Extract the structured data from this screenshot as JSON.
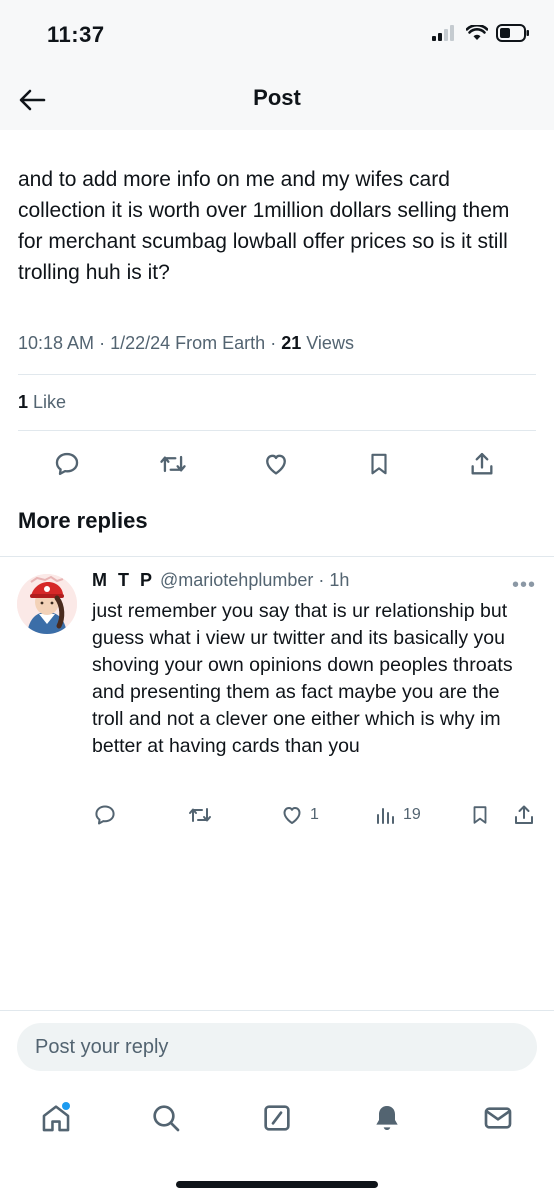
{
  "status_bar": {
    "time": "11:37"
  },
  "header": {
    "title": "Post"
  },
  "post": {
    "text": "and to add more info on me and my wifes card collection it is worth over 1million dollars selling them for merchant scumbag lowball offer prices so is it still trolling huh is it?",
    "time": "10:18 AM",
    "date": "1/22/24",
    "source": "From Earth",
    "views_count": "21",
    "views_label": "Views",
    "likes_count": "1",
    "likes_label": "Like"
  },
  "section": {
    "more_replies": "More replies"
  },
  "reply": {
    "name": "M T P",
    "handle": "@mariotehplumber",
    "age": "1h",
    "text": "just remember you say that is ur relationship but guess what i view ur twitter and its basically you shoving your own opinions down peoples throats and presenting them as fact maybe you are the troll and not a clever one either which is why im better at having cards than you",
    "like_count": "1",
    "view_count": "19",
    "more": "•••"
  },
  "composer": {
    "placeholder": "Post your reply"
  },
  "colors": {
    "text": "#0f1419",
    "secondary": "#536471",
    "accent": "#1d9bf0",
    "divider": "#e1e8ed"
  },
  "icons": [
    "back-arrow-icon",
    "reply-icon",
    "repost-icon",
    "like-icon",
    "bookmark-icon",
    "share-icon",
    "views-icon",
    "home-icon",
    "search-icon",
    "compose-icon",
    "notifications-icon",
    "messages-icon"
  ]
}
